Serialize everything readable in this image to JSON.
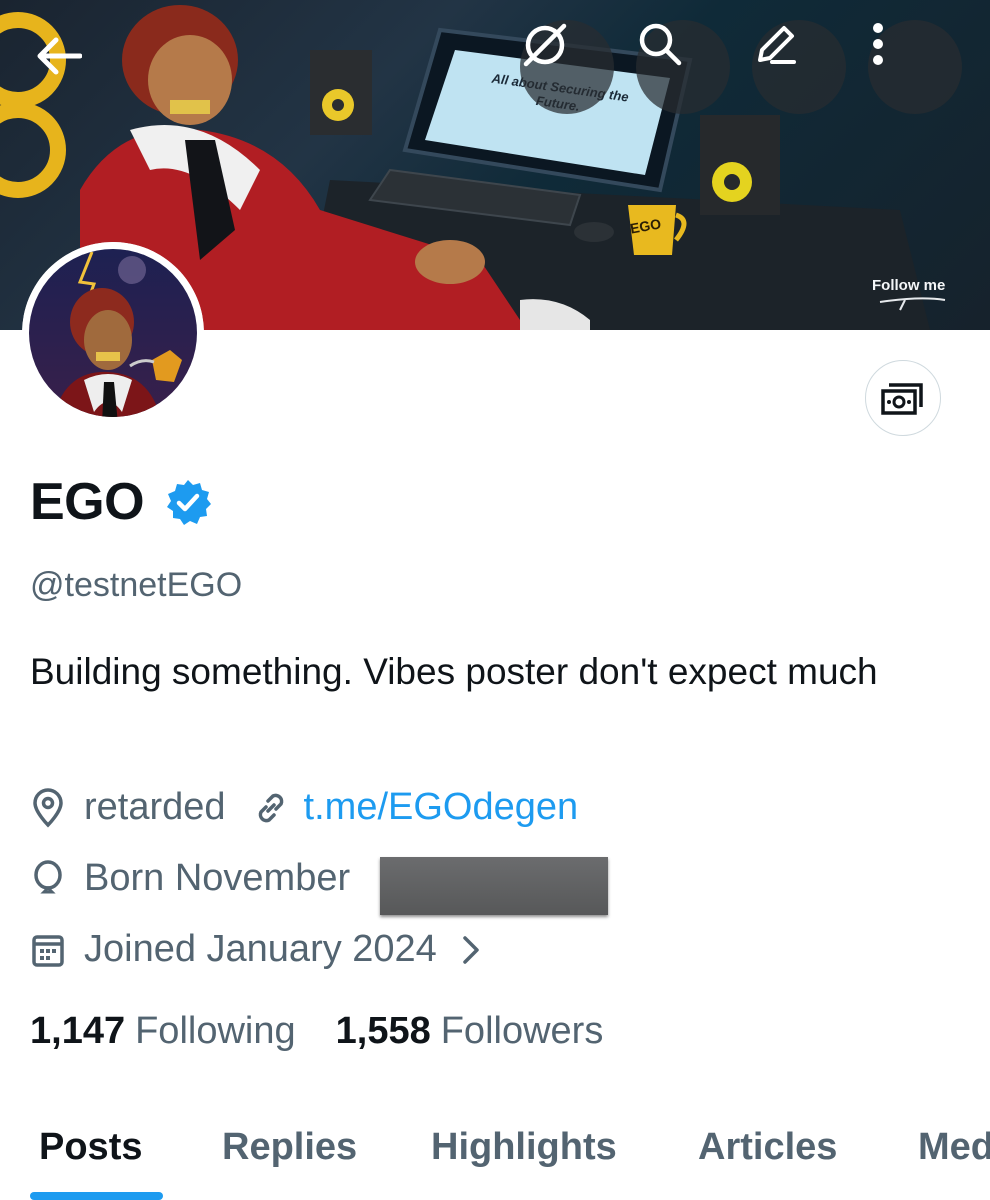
{
  "header": {
    "banner_caption": "Follow me",
    "banner_screen_text": "All about Securing the Future.",
    "banner_mug_text": "EGO",
    "icons": [
      "back-arrow-icon",
      "grok-icon",
      "search-icon",
      "edit-icon",
      "more-vertical-icon"
    ]
  },
  "profile": {
    "name": "EGO",
    "handle": "@testnetEGO",
    "bio": "Building something. Vibes poster don't expect much",
    "location": "retarded",
    "link": "t.me/EGOdegen",
    "birthday": "Born November",
    "joined": "Joined January 2024",
    "following_count": "1,147",
    "following_label": "Following",
    "followers_count": "1,558",
    "followers_label": "Followers"
  },
  "tabs": [
    "Posts",
    "Replies",
    "Highlights",
    "Articles",
    "Media"
  ],
  "colors": {
    "accent": "#1d9bf0",
    "text_primary": "#0f1419",
    "text_secondary": "#536471"
  }
}
